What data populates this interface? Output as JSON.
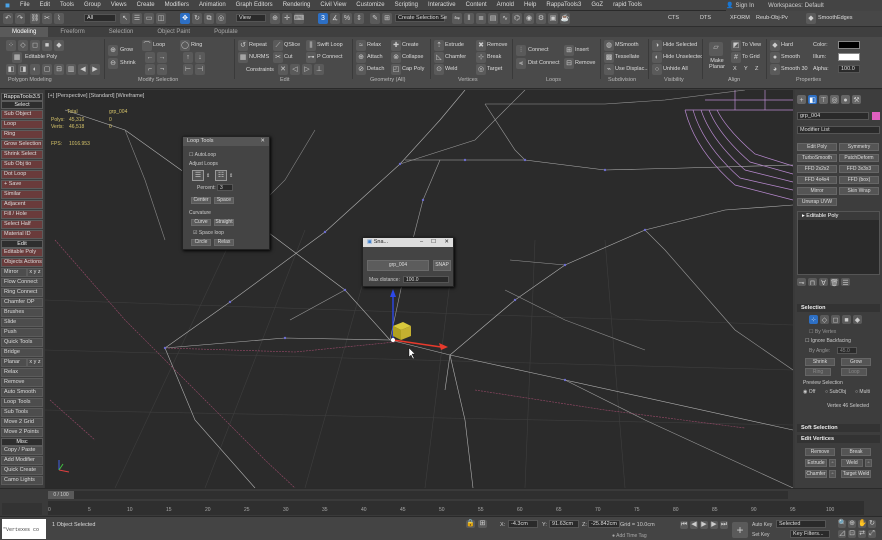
{
  "menu": [
    "File",
    "Edit",
    "Tools",
    "Group",
    "Views",
    "Create",
    "Modifiers",
    "Animation",
    "Graph Editors",
    "Rendering",
    "Civil View",
    "Customize",
    "Scripting",
    "Interactive",
    "Content",
    "Arnold",
    "Help",
    "RappaTools3",
    "GoZ",
    "rapid Tools"
  ],
  "signin": "Sign In",
  "workspaces_label": "Workspaces:",
  "workspaces_value": "Default",
  "toolbar": {
    "filter": "All",
    "view": "View",
    "selection_set": "Create Selection Se",
    "right_items": [
      "CTS",
      "DTS",
      "XFORM",
      "Reub-Obj-Pv",
      "SmoothEdges"
    ]
  },
  "tabs": [
    "Modeling",
    "Freeform",
    "Selection",
    "Object Paint",
    "Populate"
  ],
  "ribbon": {
    "editable_poly": "Editable Poly",
    "modify_selection": {
      "grow": "Grow",
      "shrink": "Shrink",
      "loop": "Loop",
      "ring": "Ring"
    },
    "edit": {
      "repeat": "Repeat",
      "qslice": "QSlice",
      "swift_loop": "Swift Loop",
      "nurms": "NURMS",
      "cut": "Cut",
      "pconnect": "P Connect",
      "constraints": "Constraints"
    },
    "geometry": {
      "relax": "Relax",
      "create": "Create",
      "attach": "Attach",
      "collapse": "Collapse",
      "detach": "Detach",
      "cap_poly": "Cap Poly"
    },
    "vertices": {
      "extrude": "Extrude",
      "remove": "Remove",
      "chamfer": "Chamfer",
      "break": "Break",
      "weld": "Weld",
      "target": "Target"
    },
    "loops": {
      "connect": "Connect",
      "dist_connect": "Dist Connect",
      "insert": "Insert",
      "remove": "Remove"
    },
    "subdivision": {
      "msmooth": "MSmooth",
      "tessellate": "Tessellate",
      "use_displac": "Use Displac..."
    },
    "visibility": {
      "hide_selected": "Hide Selected",
      "hide_unselected": "Hide Unselected",
      "unhide_all": "Unhide All"
    },
    "align": {
      "make_planar": "Make Planar",
      "to_view": "To View",
      "to_grid": "To Grid",
      "x": "X",
      "y": "Y",
      "z": "Z"
    },
    "properties": {
      "hard": "Hard",
      "smooth": "Smooth",
      "smooth30": "Smooth 30",
      "color": "Color:",
      "illum": "Illum:",
      "alpha": "Alpha:",
      "alpha_value": "100.0"
    },
    "sections": [
      "Polygon Modeling",
      "Modify Selection",
      "Edit",
      "Geometry (All)",
      "Vertices",
      "Loops",
      "Subdivision",
      "Visibility",
      "Align",
      "Properties"
    ]
  },
  "left_panel": {
    "title": "RappaTools3.5",
    "items": [
      "Select",
      "Sub Object",
      "Loop",
      "Ring",
      "Grow Selection",
      "Shrink Select",
      "Sub Obj tio",
      "Dot Loop",
      "+ Save",
      "Similar",
      "Adjacent",
      "Fill / Hole",
      "Select Half",
      "Material ID",
      "Edit",
      "Editable Poly",
      "Objects Actions",
      "Mirror",
      "x y z",
      "Flow Connect",
      "Ring Connect",
      "Chamfer OP",
      "Brushes",
      "Slide",
      "Push",
      "Quick Tools",
      "Bridge",
      "Planar",
      "x y z",
      "Relax",
      "Remove",
      "Auto Smooth",
      "Loop Tools",
      "Sub Tools",
      "Move 2 Grid",
      "Move 2 Points",
      "Misc",
      "Copy / Paste",
      "Add Modifier",
      "Quick Create",
      "Camo Lights"
    ]
  },
  "viewport": {
    "label": "[+] [Perspective] [Standard] [Wireframe]",
    "stats": {
      "total_label": "Total",
      "obj_label": "grp_004",
      "polys_label": "Polys:",
      "polys_value": "45,316",
      "polys_obj": "0",
      "verts_label": "Verts:",
      "verts_value": "46,518",
      "verts_obj": "0",
      "fps_label": "FPS:",
      "fps_value": "1016.953"
    }
  },
  "loop_tools": {
    "title": "Loop Tools",
    "autoloop": "AutoLoop",
    "adjust_loops": "Adjust Loops",
    "percent_label": "Percent:",
    "percent_value": "3",
    "center": "Center",
    "space": "Space",
    "curvature": "Curvature",
    "curve": "Curve",
    "straight": "Straight",
    "space_loop": "Space loop",
    "circle": "Circle",
    "relax": "Relax"
  },
  "snap_dialog": {
    "title": "Sna...",
    "object": "grp_004",
    "snap": "SNAP",
    "max_distance_label": "Max distance:",
    "max_distance_value": "100.0"
  },
  "right_panel": {
    "object_name": "grp_004",
    "modifier_list": "Modifier List",
    "modifier_buttons": [
      "Edit Poly",
      "Symmetry",
      "TurboSmooth",
      "PatchDeform",
      "FFD 2x2x2",
      "FFD 3x3x3",
      "FFD 4x4x4",
      "FFD (box)",
      "Mirror",
      "Skin Wrap",
      "Unwrap UVW"
    ],
    "stack_item": "Editable Poly",
    "selection_header": "Selection",
    "by_vertex": "By Vertex",
    "ignore_backfacing": "Ignore Backfacing",
    "by_angle": "By Angle:",
    "by_angle_value": "45.0",
    "shrink": "Shrink",
    "grow": "Grow",
    "ring": "Ring",
    "loop": "Loop",
    "preview_selection": "Preview Selection",
    "off": "Off",
    "subobj": "SubObj",
    "multi": "Multi",
    "selected_text": "Vertex 46 Selected",
    "soft_selection": "Soft Selection",
    "edit_vertices": "Edit Vertices",
    "remove": "Remove",
    "break": "Break",
    "extrude": "Extrude",
    "weld": "Weld",
    "chamfer": "Chamfer",
    "target_weld": "Target Weld"
  },
  "timeline": {
    "frame_label": "0 / 100",
    "ticks": [
      "0",
      "5",
      "10",
      "15",
      "20",
      "25",
      "30",
      "35",
      "40",
      "45",
      "50",
      "55",
      "60",
      "65",
      "70",
      "75",
      "80",
      "85",
      "90",
      "95",
      "100"
    ]
  },
  "status": {
    "maxscript": "\"Vertexes co",
    "selected": "1 Object Selected",
    "x_label": "X:",
    "x_value": "-4.3cm",
    "y_label": "Y:",
    "y_value": "91.63cm",
    "z_label": "Z:",
    "z_value": "-25.842cm",
    "grid": "Grid = 10.0cm",
    "add_time_tag": "Add Time Tag",
    "auto_key": "Auto Key",
    "set_key": "Set Key",
    "selected_dropdown": "Selected",
    "key_filters": "Key Filters..."
  }
}
